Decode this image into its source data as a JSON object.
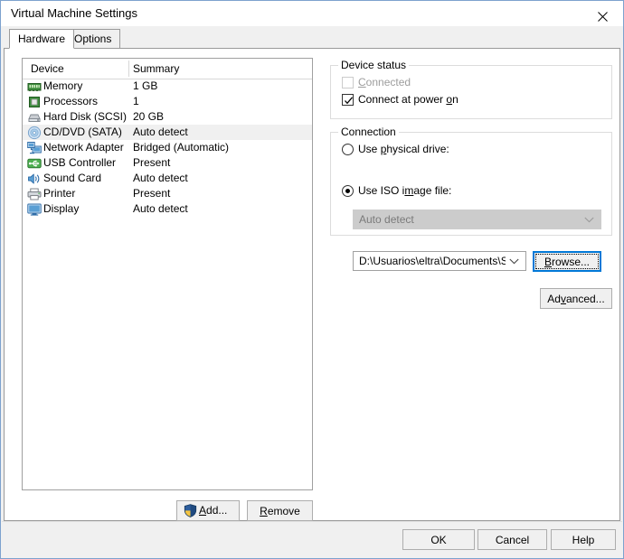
{
  "window": {
    "title": "Virtual Machine Settings",
    "close_icon": "close-icon"
  },
  "tabs": [
    {
      "label": "Hardware",
      "active": true
    },
    {
      "label": "Options",
      "active": false
    }
  ],
  "device_list": {
    "columns": {
      "device": "Device",
      "summary": "Summary"
    },
    "rows": [
      {
        "icon": "memory-icon",
        "name": "Memory",
        "summary": "1 GB",
        "selected": false
      },
      {
        "icon": "processor-icon",
        "name": "Processors",
        "summary": "1",
        "selected": false
      },
      {
        "icon": "hard-disk-icon",
        "name": "Hard Disk (SCSI)",
        "summary": "20 GB",
        "selected": false
      },
      {
        "icon": "cd-dvd-icon",
        "name": "CD/DVD (SATA)",
        "summary": "Auto detect",
        "selected": true
      },
      {
        "icon": "network-adapter-icon",
        "name": "Network Adapter",
        "summary": "Bridged (Automatic)",
        "selected": false
      },
      {
        "icon": "usb-controller-icon",
        "name": "USB Controller",
        "summary": "Present",
        "selected": false
      },
      {
        "icon": "sound-card-icon",
        "name": "Sound Card",
        "summary": "Auto detect",
        "selected": false
      },
      {
        "icon": "printer-icon",
        "name": "Printer",
        "summary": "Present",
        "selected": false
      },
      {
        "icon": "display-icon",
        "name": "Display",
        "summary": "Auto detect",
        "selected": false
      }
    ],
    "add_label": "Add...",
    "add_icon": "uac-shield-icon",
    "remove_label": "Remove"
  },
  "device_status": {
    "legend": "Device status",
    "connected": {
      "label": "Connected",
      "checked": false,
      "enabled": false
    },
    "connect_at_power_on": {
      "label": "Connect at power on",
      "checked": true,
      "enabled": true
    }
  },
  "connection": {
    "legend": "Connection",
    "use_physical_drive": {
      "label": "Use physical drive:",
      "selected": false
    },
    "physical_drive_value": "Auto detect",
    "use_iso_image": {
      "label": "Use ISO image file:",
      "selected": true
    },
    "iso_path": "D:\\Usuarios\\eltra\\Documents\\Siste",
    "browse_label": "Browse...",
    "advanced_label": "Advanced..."
  },
  "footer": {
    "ok_label": "OK",
    "cancel_label": "Cancel",
    "help_label": "Help"
  },
  "colors": {
    "window_border": "#7da2ce",
    "dialog_bg": "#f0f0f0",
    "panel_bg": "#ffffff",
    "focus_blue": "#0078d7",
    "selected_row": "#f0f0f0",
    "disabled_text": "#9d9d9d",
    "shield_blue": "#2f5f9e",
    "shield_gold": "#f5c542"
  }
}
